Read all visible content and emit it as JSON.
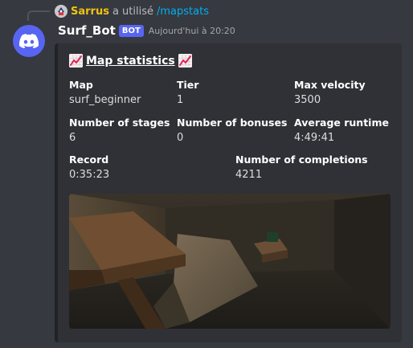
{
  "reply": {
    "user": "Sarrus",
    "text": "a utilisé",
    "command": "/mapstats"
  },
  "message": {
    "username": "Surf_Bot",
    "badge": "BOT",
    "timestamp": "Aujourd'hui à 20:20"
  },
  "embed": {
    "title": "Map statistics",
    "title_icon": "chart-increasing-emoji",
    "fields": [
      {
        "name": "Map",
        "value": "surf_beginner"
      },
      {
        "name": "Tier",
        "value": "1"
      },
      {
        "name": "Max velocity",
        "value": "3500"
      },
      {
        "name": "Number of stages",
        "value": "6"
      },
      {
        "name": "Number of bonuses",
        "value": "0"
      },
      {
        "name": "Average runtime",
        "value": "4:49:41"
      },
      {
        "name": "Record",
        "value": "0:35:23"
      },
      {
        "name": "Number of completions",
        "value": "4211"
      }
    ]
  },
  "colors": {
    "background": "#36393f",
    "embed_background": "#2f3136",
    "embed_border": "#202225",
    "bot_badge": "#5865f2",
    "reply_user": "#f1c40f",
    "command_link": "#00aff4"
  }
}
